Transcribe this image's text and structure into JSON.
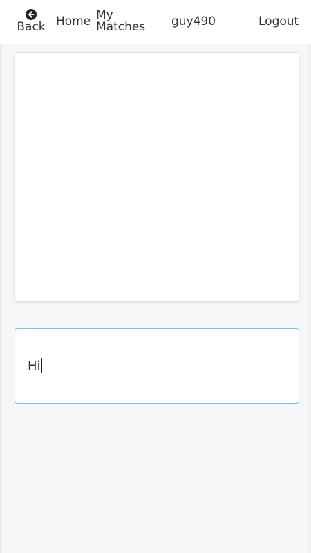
{
  "nav": {
    "back_label": "Back",
    "home_label": "Home",
    "matches_line1": "My",
    "matches_line2": "Matches",
    "username": "guy490",
    "logout_label": "Logout"
  },
  "chat": {
    "input_value": "Hi"
  },
  "colors": {
    "background": "#f5f6f8",
    "input_border_focus": "#7fbfe0"
  },
  "icons": {
    "back": "arrow-circle-left-icon"
  }
}
